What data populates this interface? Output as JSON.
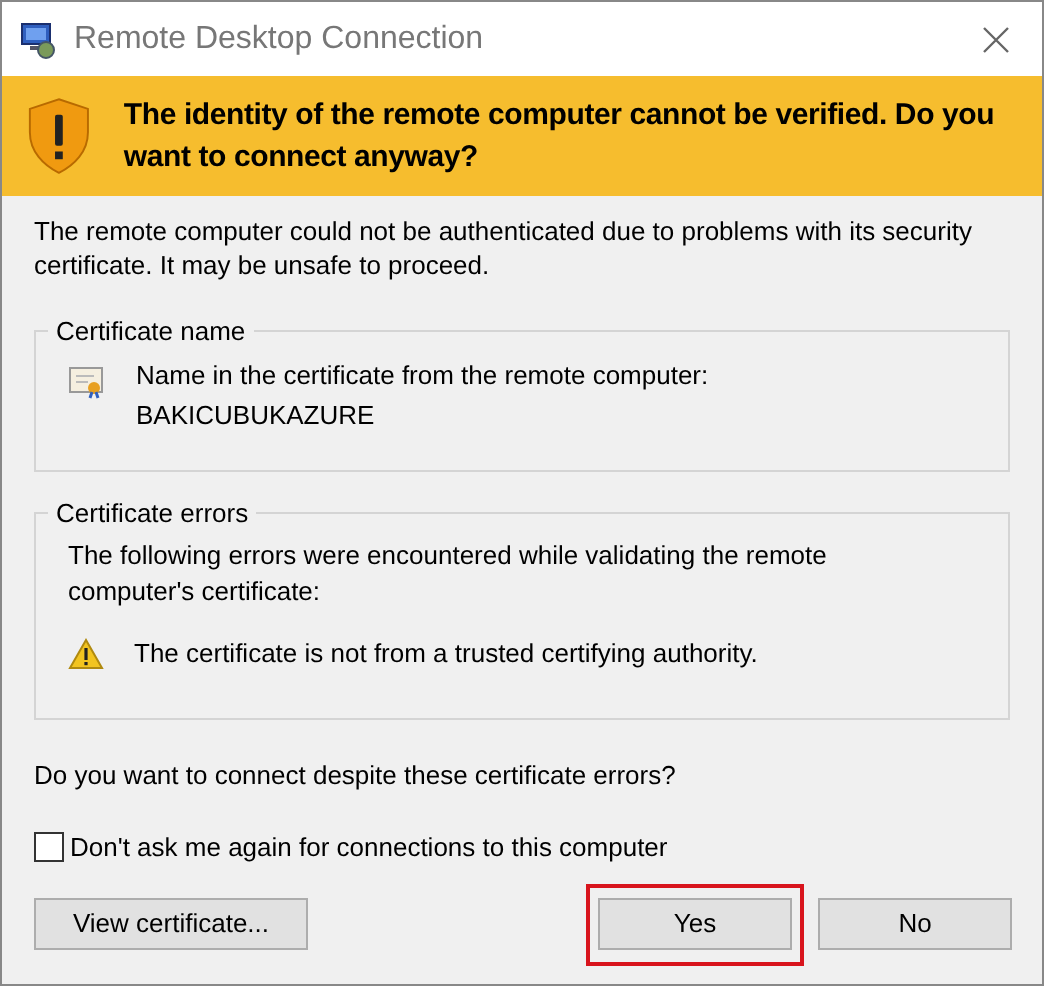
{
  "window": {
    "title": "Remote Desktop Connection"
  },
  "banner": {
    "message": "The identity of the remote computer cannot be verified. Do you want to connect anyway?"
  },
  "description": "The remote computer could not be authenticated due to problems with its security certificate. It may be unsafe to proceed.",
  "certificate_name": {
    "title": "Certificate name",
    "label": "Name in the certificate from the remote computer:",
    "value": "BAKICUBUKAZURE"
  },
  "certificate_errors": {
    "title": "Certificate errors",
    "intro": "The following errors were encountered while validating the remote computer's certificate:",
    "errors": [
      "The certificate is not from a trusted certifying authority."
    ]
  },
  "question": "Do you want to connect despite these certificate errors?",
  "dont_ask_again": {
    "label": "Don't ask me again for connections to this computer",
    "checked": false
  },
  "buttons": [
    {
      "label": "View certificate...",
      "highlighted": false
    },
    {
      "label": "Yes",
      "highlighted": true
    },
    {
      "label": "No",
      "highlighted": false
    }
  ]
}
